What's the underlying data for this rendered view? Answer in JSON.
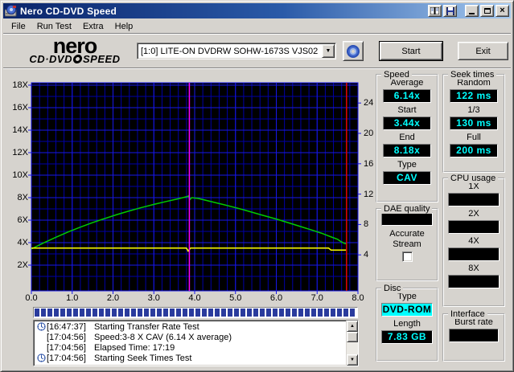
{
  "window": {
    "title": "Nero CD-DVD Speed"
  },
  "menu": {
    "items": [
      "File",
      "Run Test",
      "Extra",
      "Help"
    ]
  },
  "header": {
    "logo_top": "nero",
    "logo_bottom_left": "CD·DVD",
    "logo_bottom_right": "SPEED",
    "drive_selected": "[1:0]   LITE-ON DVDRW SOHW-1673S VJS02",
    "start_label": "Start",
    "exit_label": "Exit"
  },
  "chart_data": {
    "type": "line",
    "plot_bg": "#000000",
    "grid_minor_color": "#0000a8",
    "grid_major_color": "#1717e8",
    "border_color": "#1717e8",
    "x_axis": {
      "min": 0,
      "max": 8,
      "major_step": 1,
      "minor_step": 0.2,
      "tick_values": [
        0,
        1,
        2,
        3,
        4,
        5,
        6,
        7,
        8
      ],
      "tick_labels": [
        "0.0",
        "1.0",
        "2.0",
        "3.0",
        "4.0",
        "5.0",
        "6.0",
        "7.0",
        "8.0"
      ]
    },
    "y_left_axis": {
      "unit": "X",
      "min": 0,
      "max": 18.2,
      "major_step": 2,
      "minor_step": 1,
      "tick_values": [
        2,
        4,
        6,
        8,
        10,
        12,
        14,
        16,
        18
      ],
      "tick_labels": [
        "2X",
        "4X",
        "6X",
        "8X",
        "10X",
        "12X",
        "14X",
        "16X",
        "18X"
      ]
    },
    "y_right_axis": {
      "min": 0,
      "max": 26.7,
      "major_step": 4,
      "tick_values": [
        4,
        8,
        12,
        16,
        20,
        24
      ],
      "tick_labels": [
        "4",
        "8",
        "12",
        "16",
        "20",
        "24"
      ]
    },
    "series": [
      {
        "name": "transfer-rate",
        "color": "#00cc00",
        "axis": "left",
        "points": [
          [
            0,
            3.44
          ],
          [
            0.3,
            3.98
          ],
          [
            0.6,
            4.48
          ],
          [
            0.9,
            4.95
          ],
          [
            1.2,
            5.38
          ],
          [
            1.5,
            5.78
          ],
          [
            1.8,
            6.15
          ],
          [
            2.1,
            6.5
          ],
          [
            2.4,
            6.82
          ],
          [
            2.7,
            7.12
          ],
          [
            3.0,
            7.4
          ],
          [
            3.3,
            7.66
          ],
          [
            3.6,
            7.9
          ],
          [
            3.8,
            8.08
          ],
          [
            3.85,
            8.15
          ],
          [
            3.88,
            7.82
          ],
          [
            3.93,
            8.0
          ],
          [
            4.1,
            7.92
          ],
          [
            4.4,
            7.65
          ],
          [
            4.8,
            7.3
          ],
          [
            5.2,
            6.92
          ],
          [
            5.6,
            6.5
          ],
          [
            6.0,
            6.1
          ],
          [
            6.4,
            5.65
          ],
          [
            6.8,
            5.2
          ],
          [
            7.1,
            4.85
          ],
          [
            7.35,
            4.5
          ],
          [
            7.5,
            4.3
          ],
          [
            7.58,
            4.1
          ],
          [
            7.66,
            3.95
          ],
          [
            7.72,
            3.88
          ]
        ]
      },
      {
        "name": "rotation-speed",
        "color": "#ffff00",
        "axis": "right",
        "points": [
          [
            0,
            4.9
          ],
          [
            3.8,
            4.9
          ],
          [
            3.84,
            4.5
          ],
          [
            3.9,
            4.9
          ],
          [
            7.28,
            4.9
          ],
          [
            7.34,
            4.62
          ],
          [
            7.73,
            4.62
          ]
        ]
      }
    ],
    "markers": [
      {
        "name": "layer-break-line",
        "type": "vline",
        "x": 3.87,
        "color": "#ff00ff"
      },
      {
        "name": "end-of-test-line",
        "type": "vline",
        "x": 7.72,
        "color": "#e00404"
      }
    ]
  },
  "progress": {
    "percent": 100
  },
  "log": {
    "lines": [
      {
        "icon": true,
        "time": "[16:47:37]",
        "text": "Starting Transfer Rate Test"
      },
      {
        "icon": false,
        "time": "[17:04:56]",
        "text": "Speed:3-8 X CAV (6.14 X average)"
      },
      {
        "icon": false,
        "time": "[17:04:56]",
        "text": "Elapsed Time: 17:19"
      },
      {
        "icon": true,
        "time": "[17:04:56]",
        "text": "Starting Seek Times Test"
      }
    ]
  },
  "panels": {
    "speed": {
      "title": "Speed",
      "fields": [
        {
          "label": "Average",
          "value": "6.14x"
        },
        {
          "label": "Start",
          "value": "3.44x"
        },
        {
          "label": "End",
          "value": "8.18x"
        },
        {
          "label": "Type",
          "value": "CAV"
        }
      ]
    },
    "seek_times": {
      "title": "Seek times",
      "fields": [
        {
          "label": "Random",
          "value": "122 ms"
        },
        {
          "label": "1/3",
          "value": "130 ms"
        },
        {
          "label": "Full",
          "value": "200 ms"
        }
      ]
    },
    "dae_quality": {
      "title": "DAE quality",
      "display_value": "",
      "accurate_stream": {
        "label_line1": "Accurate",
        "label_line2": "Stream",
        "checked": false
      }
    },
    "cpu_usage": {
      "title": "CPU usage",
      "fields": [
        {
          "label": "1X",
          "value": ""
        },
        {
          "label": "2X",
          "value": ""
        },
        {
          "label": "4X",
          "value": ""
        },
        {
          "label": "8X",
          "value": ""
        }
      ]
    },
    "disc": {
      "title": "Disc",
      "fields": [
        {
          "label": "Type",
          "value": "DVD-ROM"
        },
        {
          "label": "Length",
          "value": "7.83 GB"
        }
      ]
    },
    "interface": {
      "title": "Interface",
      "fields": [
        {
          "label": "Burst rate",
          "value": ""
        }
      ]
    }
  },
  "colors": {
    "lcd_text": "#00ffff",
    "lcd_bg": "#000000",
    "titlebar_left": "#0a246a",
    "titlebar_right": "#a6caf0",
    "window_gray": "#d6d3ce",
    "progress_block": "#2a3b9d"
  }
}
